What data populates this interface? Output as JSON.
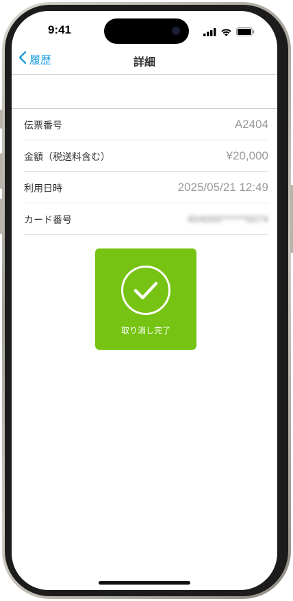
{
  "status_bar": {
    "time": "9:41"
  },
  "nav": {
    "back_label": "履歴",
    "title": "詳細"
  },
  "details": {
    "rows": [
      {
        "label": "伝票番号",
        "value": "A2404"
      },
      {
        "label": "金額（税送料含む）",
        "value": "¥20,000"
      },
      {
        "label": "利用日時",
        "value": "2025/05/21 12:49"
      },
      {
        "label": "カード番号",
        "value": "404000******5074"
      }
    ]
  },
  "status_card": {
    "message": "取り消し完了",
    "color": "#76c313"
  },
  "colors": {
    "accent": "#1a9be0",
    "success": "#76c313"
  },
  "icons": {
    "back": "chevron-left-icon",
    "check": "checkmark-circle-icon",
    "signal": "cellular-signal-icon",
    "wifi": "wifi-icon",
    "battery": "battery-icon"
  }
}
